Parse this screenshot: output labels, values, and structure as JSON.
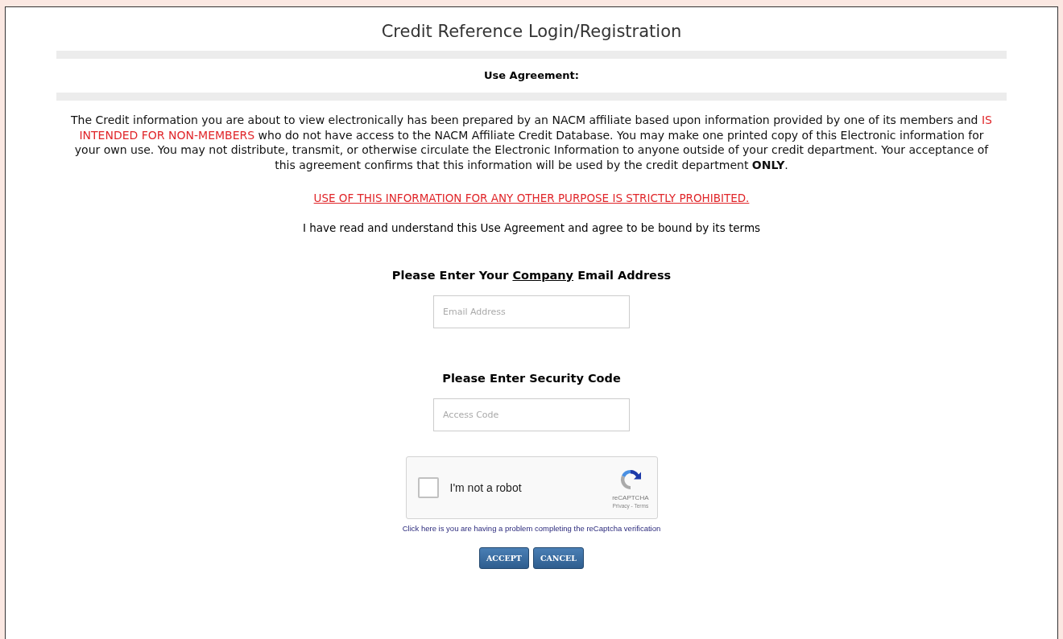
{
  "title": "Credit Reference Login/Registration",
  "section_heading": "Use Agreement:",
  "agreement": [
    {
      "text": "The Credit information you are about to view electronically has been prepared by an NACM affiliate  based upon information provided by one of its members and ",
      "kind": "plain"
    },
    {
      "text": "IS INTENDED FOR NON-MEMBERS",
      "kind": "alert"
    },
    {
      "text": " who do not have access to the NACM Affiliate Credit Database. You may make one printed copy of this Electronic information for your own use. You may not distribute, transmit, or otherwise circulate the Electronic Information to anyone outside of your credit department. Your acceptance of this agreement confirms that this information will be used by the credit department ",
      "kind": "plain"
    },
    {
      "text": "ONLY",
      "kind": "bold"
    },
    {
      "text": ".",
      "kind": "plain"
    }
  ],
  "warning": "USE OF THIS INFORMATION FOR ANY OTHER PURPOSE IS STRICTLY PROHIBITED.",
  "consent": "I have read and understand this Use Agreement and agree to be bound by its terms",
  "email_heading": [
    {
      "text": "Please Enter Your ",
      "kind": "plain"
    },
    {
      "text": "Company",
      "kind": "underline"
    },
    {
      "text": " Email Address",
      "kind": "plain"
    }
  ],
  "email_field": {
    "placeholder": "Email Address"
  },
  "code_heading": "Please Enter Security Code",
  "code_field": {
    "placeholder": "Access Code"
  },
  "captcha": {
    "label": "I'm not a robot",
    "checked": false,
    "brand": "reCAPTCHA",
    "links": "Privacy - Terms"
  },
  "help_link": "Click here is you are having a problem completing the reCaptcha verification",
  "buttons": [
    "ACCEPT",
    "CANCEL"
  ]
}
